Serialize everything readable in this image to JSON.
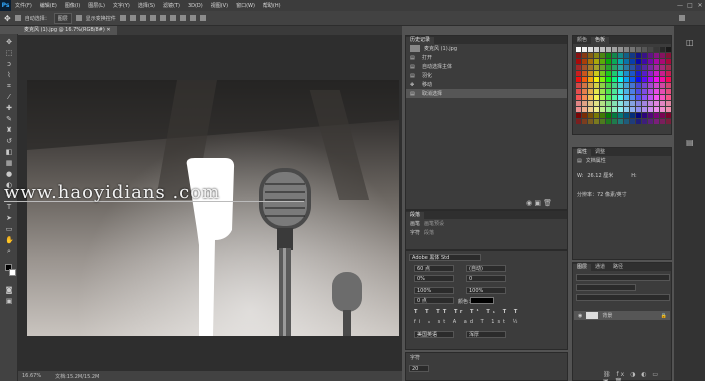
{
  "app": {
    "logo": "Ps"
  },
  "menu": [
    "文件(F)",
    "编辑(E)",
    "图像(I)",
    "图层(L)",
    "文字(Y)",
    "选择(S)",
    "滤镜(T)",
    "3D(D)",
    "视图(V)",
    "窗口(W)",
    "帮助(H)"
  ],
  "window_controls": [
    "—",
    "□",
    "✕"
  ],
  "options_bar": {
    "auto_select_label": "自动选择：",
    "auto_select_value": "图层",
    "show_transform_label": "显示变换控件"
  },
  "document": {
    "tab_label": "麦克风 (1).jpg @ 16.7%(RGB/8#) ✕",
    "zoom_status": "16.67%",
    "doc_size_status": "文档:15.2M/15.2M"
  },
  "watermark": "www.haoyidians    .com",
  "history_panel": {
    "tab": "历史记录",
    "snapshot": "麦克风 (1).jpg",
    "items": [
      "打开",
      "自动选择主体",
      "羽化",
      "移动",
      "取消选择"
    ],
    "selected_index": 4
  },
  "color_panels": {
    "tabs": [
      "颜色",
      "色板"
    ]
  },
  "properties_panel": {
    "tabs": [
      "属性",
      "调整"
    ],
    "doc_label": "文档属性",
    "w_label": "W:",
    "w_value": "26.12 厘米",
    "h_label": "H:",
    "res_label": "分辨率：72 像素/英寸"
  },
  "mid_panel": {
    "tabs": [
      "段落",
      "字符"
    ],
    "row1": [
      "画笔",
      "画笔预设"
    ],
    "row2": [
      "字符",
      "段落"
    ]
  },
  "character_panel": {
    "font": "Adobe 黑体 Std",
    "size": "60 点",
    "leading": "(自动)",
    "tracking": "0%",
    "kerning": "0",
    "scale_v": "100%",
    "scale_h": "100%",
    "baseline": "0 点",
    "color_label": "颜色：",
    "language": "美国英语",
    "anti_alias": "浑厚"
  },
  "layers_panel": {
    "tabs": [
      "图层",
      "通道",
      "路径"
    ],
    "layer_name": "背景"
  },
  "bottom_left_panel": {
    "label": "字符",
    "value": "20"
  }
}
